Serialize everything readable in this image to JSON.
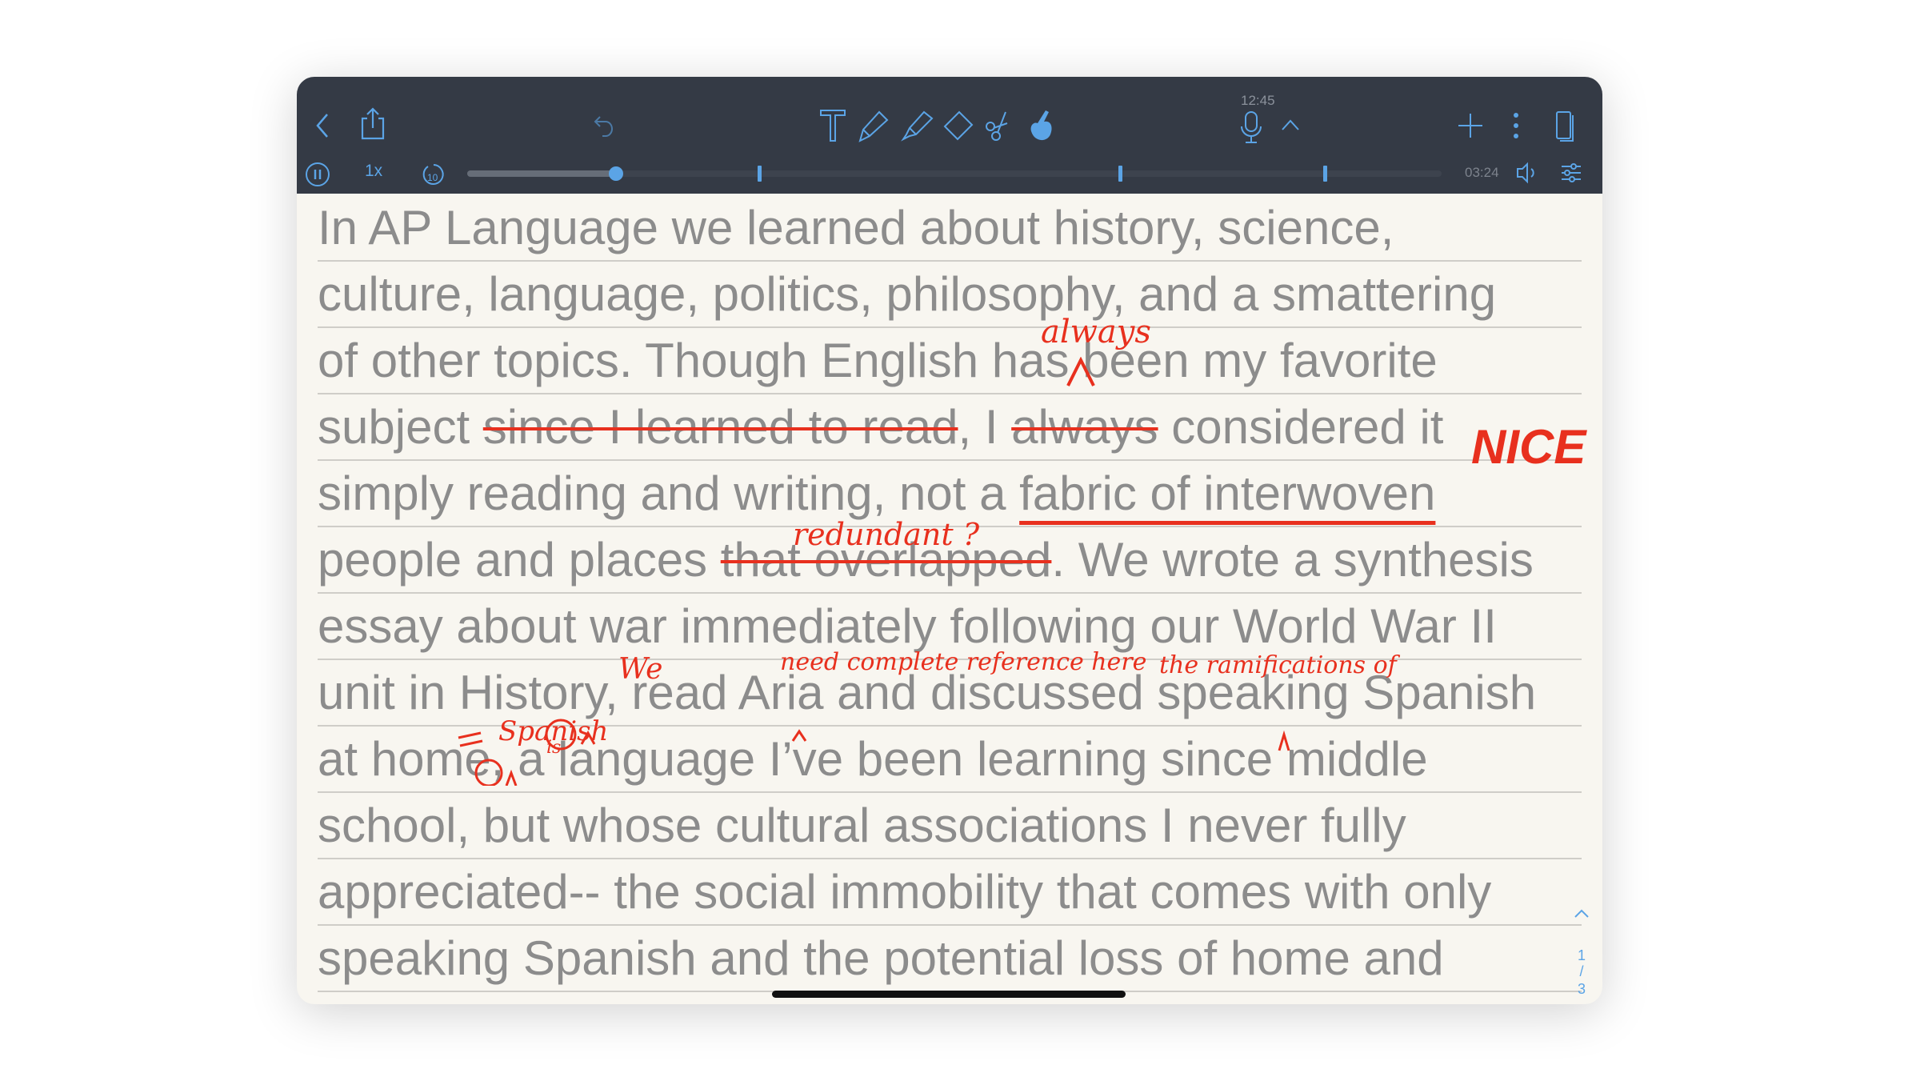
{
  "toolbar": {
    "clock": "12:45",
    "speed": "1x",
    "elapsed": "03:24",
    "playback_progress": 0.153,
    "bookmarks": [
      0.3,
      0.67,
      0.88
    ],
    "icons": [
      "back-icon",
      "share-icon",
      "undo-icon",
      "text-tool-icon",
      "pen-icon",
      "highlighter-icon",
      "eraser-icon",
      "scissors-icon",
      "hand-icon",
      "microphone-icon",
      "chevron-up-icon",
      "plus-icon",
      "more-icon",
      "pages-icon",
      "pause-icon",
      "skip-back-10-icon",
      "speaker-icon",
      "settings-sliders-icon"
    ]
  },
  "document": {
    "lines": [
      [
        {
          "t": "In AP Language we learned about history, science,"
        }
      ],
      [
        {
          "t": "culture, language, politics, philosophy, and a smattering"
        }
      ],
      [
        {
          "t": "of other topics. Though English has been my favorite"
        }
      ],
      [
        {
          "t": "subject "
        },
        {
          "t": "since I learned to read",
          "s": "strike"
        },
        {
          "t": ", I "
        },
        {
          "t": "always",
          "s": "strike"
        },
        {
          "t": " considered it"
        }
      ],
      [
        {
          "t": "simply reading and writing, not a "
        },
        {
          "t": "fabric of interwoven",
          "s": "under"
        }
      ],
      [
        {
          "t": "people and places "
        },
        {
          "t": "that overlapped",
          "s": "strike"
        },
        {
          "t": ". We wrote a synthesis"
        }
      ],
      [
        {
          "t": "essay about war immediately following our World War II"
        }
      ],
      [
        {
          "t": "unit in History, read Aria and discussed speaking Spanish"
        }
      ],
      [
        {
          "t": "at home, a language I’ve been learning since middle"
        }
      ],
      [
        {
          "t": "school, but whose cultural associations I never fully"
        }
      ],
      [
        {
          "t": "appreciated-- the social immobility that comes with only"
        }
      ],
      [
        {
          "t": "speaking Spanish and the potential loss of home and"
        }
      ]
    ],
    "annotations": {
      "always": "always",
      "nice": "NICE",
      "redundant": "redundant ?",
      "reference": "need complete reference here",
      "ramifications": "the ramifications of",
      "we": "We",
      "spanish": "Spanish",
      "is": "is"
    },
    "annotation_color": "#e8301e"
  },
  "pager": {
    "current": "1",
    "separator": "/",
    "total": "3"
  }
}
